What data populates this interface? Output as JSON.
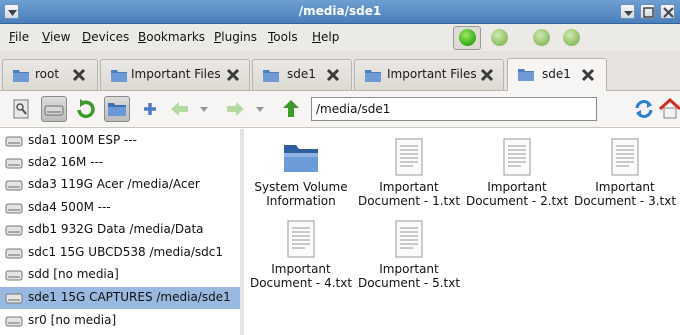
{
  "window": {
    "title": "/media/sde1"
  },
  "menu": [
    {
      "label": "File",
      "accel": "F",
      "rest": "ile"
    },
    {
      "label": "View",
      "accel": "V",
      "rest": "iew"
    },
    {
      "label": "Devices",
      "accel": "D",
      "rest": "evices"
    },
    {
      "label": "Bookmarks",
      "accel": "B",
      "rest": "ookmarks"
    },
    {
      "label": "Plugins",
      "accel": "P",
      "rest": "lugins"
    },
    {
      "label": "Tools",
      "accel": "T",
      "rest": "ools"
    },
    {
      "label": "Help",
      "accel": "H",
      "rest": "elp"
    }
  ],
  "tabs": [
    {
      "label": "root",
      "active": false
    },
    {
      "label": "Important Files",
      "active": false
    },
    {
      "label": "sde1",
      "active": false
    },
    {
      "label": "Important Files",
      "active": false
    },
    {
      "label": "sde1",
      "active": true
    }
  ],
  "toolbar": {
    "path_value": "/media/sde1"
  },
  "devices": [
    {
      "label": "sda1 100M ESP ---",
      "selected": false
    },
    {
      "label": "sda2 16M ---",
      "selected": false
    },
    {
      "label": "sda3 119G Acer /media/Acer",
      "selected": false
    },
    {
      "label": "sda4 500M ---",
      "selected": false
    },
    {
      "label": "sdb1 932G Data /media/Data",
      "selected": false
    },
    {
      "label": "sdc1 15G UBCD538 /media/sdc1",
      "selected": false
    },
    {
      "label": "sdd [no media]",
      "selected": false
    },
    {
      "label": "sde1 15G CAPTURES /media/sde1",
      "selected": true
    },
    {
      "label": "sr0 [no media]",
      "selected": false
    }
  ],
  "files": [
    {
      "line1": "System Volume",
      "line2": "Information",
      "kind": "folder"
    },
    {
      "line1": "Important",
      "line2": "Document - 1.txt",
      "kind": "text"
    },
    {
      "line1": "Important",
      "line2": "Document - 2.txt",
      "kind": "text"
    },
    {
      "line1": "Important",
      "line2": "Document - 3.txt",
      "kind": "text"
    },
    {
      "line1": "Important",
      "line2": "Document - 4.txt",
      "kind": "text"
    },
    {
      "line1": "Important",
      "line2": "Document - 5.txt",
      "kind": "text"
    }
  ],
  "colors": {
    "titlebar": "#4a7fbc",
    "selection": "#9ab9e0",
    "status_active": "#3cae1e",
    "status_idle": "#8ebd62"
  }
}
